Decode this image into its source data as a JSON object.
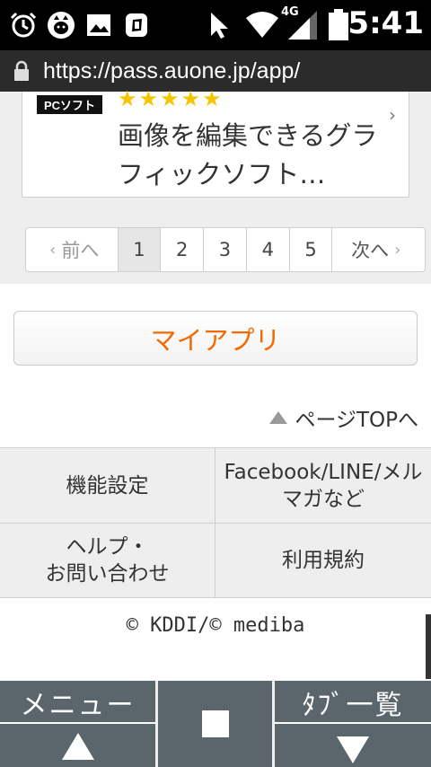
{
  "status_bar": {
    "time": "5:41",
    "network": "4G",
    "icons": [
      "alarm-icon",
      "cat-icon",
      "image-icon",
      "app-icon",
      "cursor-icon",
      "wifi-icon",
      "signal-icon",
      "battery-icon"
    ]
  },
  "browser": {
    "url": "https://pass.auone.jp/app/",
    "lock_icon": "lock-icon"
  },
  "app_card": {
    "badge": "PCソフト",
    "rating": 5,
    "stars": "★★★★★",
    "description": "画像を編集できるグラフィックソフト…",
    "chevron": "›"
  },
  "pagination": {
    "prev_label": "前へ",
    "next_label": "次へ",
    "pages": [
      "1",
      "2",
      "3",
      "4",
      "5"
    ],
    "current": "1"
  },
  "my_apps_button": "マイアプリ",
  "page_top_link": "ページTOPへ",
  "footer_links": {
    "settings": "機能設定",
    "social": "Facebook/LINE/メルマガなど",
    "help_line1": "ヘルプ・",
    "help_line2": "お問い合わせ",
    "terms": "利用規約"
  },
  "copyright": "© KDDI/© mediba",
  "bottom_bar": {
    "menu_label": "メニュー",
    "tabs_label": "ﾀﾌﾞ一覧"
  },
  "colors": {
    "accent": "#f26a00",
    "star": "#f6c500",
    "bottom_bar": "#5a656c"
  }
}
